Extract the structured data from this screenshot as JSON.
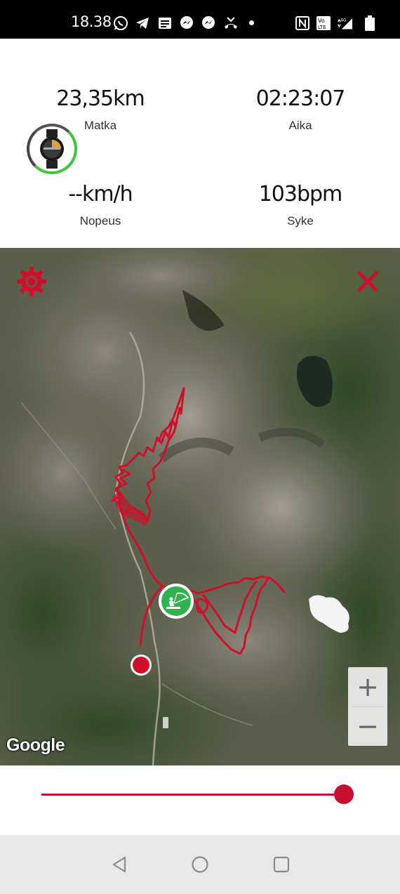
{
  "status_bar": {
    "time": "18.38",
    "icons": [
      "whatsapp-icon",
      "telegram-icon",
      "news-icon",
      "messenger-icon",
      "messenger-icon",
      "missed-call-icon",
      "dot-icon",
      "nfc-icon",
      "volte-icon",
      "signal-4g-icon",
      "battery-icon"
    ]
  },
  "stats": {
    "distance": {
      "value": "23,35km",
      "label": "Matka"
    },
    "time": {
      "value": "02:23:07",
      "label": "Aika"
    },
    "speed": {
      "value": "--km/h",
      "label": "Nopeus"
    },
    "heart_rate": {
      "value": "103bpm",
      "label": "Syke"
    },
    "watch_icon": "watch-icon"
  },
  "map": {
    "attribution": "Google",
    "zoom_in_label": "+",
    "zoom_out_label": "−",
    "settings_icon": "gear-icon",
    "close_icon": "close-icon",
    "track_color": "#d0102a",
    "current_marker_color": "#2fb34f",
    "start_marker_color": "#d0102a"
  },
  "slider": {
    "position": 1.0,
    "color": "#c8102e"
  },
  "nav_bar": {
    "icons": [
      "back-icon",
      "home-icon",
      "recents-icon"
    ]
  }
}
